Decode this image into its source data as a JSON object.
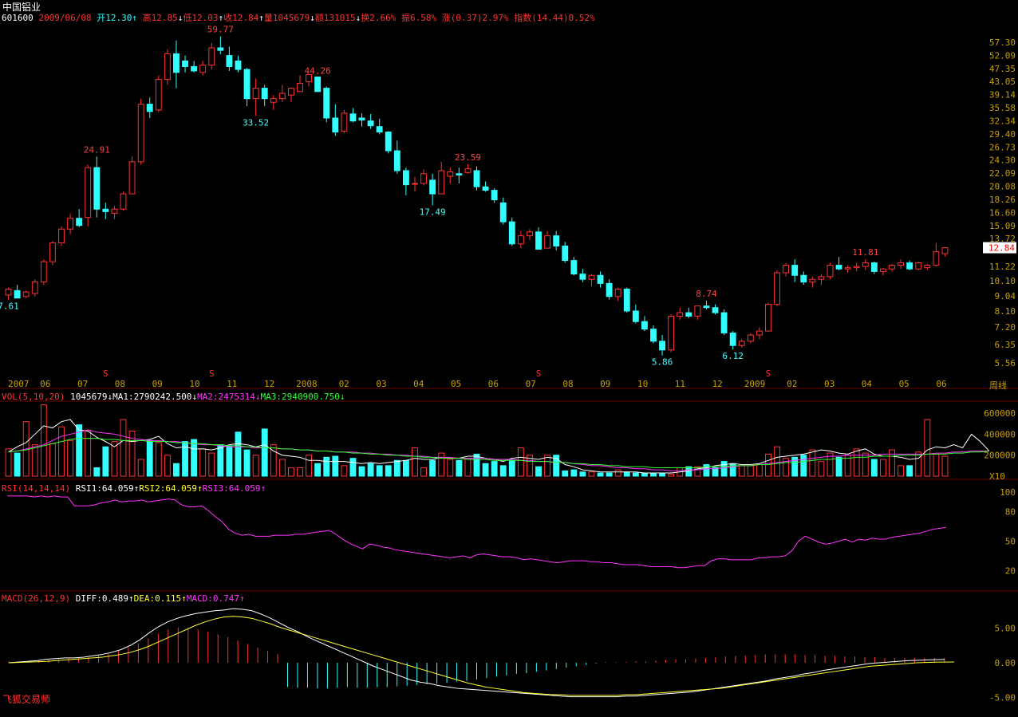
{
  "header": {
    "stock_name": "中国铝业",
    "stock_code": "601600",
    "date": "2009/06/08",
    "open_label": "开12.30",
    "high_label": "高12.85",
    "low_label": "低12.03",
    "close_label": "收12.84",
    "volume_label": "量1045679",
    "amount_label": "额131015",
    "turnover_label": "换2.66%",
    "amplitude_label": "振6.58%",
    "change_label": "涨(0.37)2.97%",
    "index_label": "指数(14.44)0.52%"
  },
  "period_label": "周线",
  "watermark": "飞狐交易师",
  "price_panel": {
    "y_ticks": [
      "57.30",
      "52.09",
      "47.35",
      "43.05",
      "39.14",
      "35.58",
      "32.34",
      "29.40",
      "26.73",
      "24.30",
      "22.09",
      "20.08",
      "18.26",
      "16.60",
      "15.09",
      "13.72",
      "11.22",
      "10.10",
      "9.04",
      "8.10",
      "7.20",
      "6.35",
      "5.56"
    ],
    "current_price": "12.84",
    "annotations": [
      {
        "text": "7.61",
        "color": "cyan"
      },
      {
        "text": "24.91",
        "color": "red"
      },
      {
        "text": "59.77",
        "color": "red"
      },
      {
        "text": "33.52",
        "color": "cyan"
      },
      {
        "text": "44.26",
        "color": "red"
      },
      {
        "text": "17.49",
        "color": "cyan"
      },
      {
        "text": "23.59",
        "color": "red"
      },
      {
        "text": "8.74",
        "color": "red"
      },
      {
        "text": "5.86",
        "color": "cyan"
      },
      {
        "text": "6.12",
        "color": "cyan"
      },
      {
        "text": "11.81",
        "color": "red"
      }
    ],
    "s_marker": "S",
    "x_labels": [
      "2007",
      "06",
      "07",
      "08",
      "09",
      "10",
      "11",
      "12",
      "2008",
      "02",
      "03",
      "04",
      "05",
      "06",
      "07",
      "08",
      "09",
      "10",
      "11",
      "12",
      "2009",
      "02",
      "03",
      "04",
      "05",
      "06"
    ]
  },
  "vol_panel": {
    "title": "VOL(5,10,20)",
    "value": "1045679",
    "ma1": "MA1:2790242.500",
    "ma2": "MA2:2475314",
    "ma3": "MA3:2940900.750",
    "y_ticks": [
      "600000",
      "400000",
      "200000"
    ],
    "unit": "X10"
  },
  "rsi_panel": {
    "title": "RSI(14,14,14)",
    "rsi1": "RSI1:64.059",
    "rsi2": "RSI2:64.059",
    "rsi3": "RSI3:64.059",
    "y_ticks": [
      "100",
      "80",
      "50",
      "20"
    ]
  },
  "macd_panel": {
    "title": "MACD(26,12,9)",
    "diff": "DIFF:0.489",
    "dea": "DEA:0.115",
    "macd": "MACD:0.747",
    "y_ticks": [
      "5.00",
      "0.00",
      "-5.00"
    ]
  },
  "colors": {
    "up": "#ff3232",
    "down": "#32ffff",
    "ma1": "#ffffff",
    "ma2": "#ff32ff",
    "ma3": "#32ff32",
    "rsi": "#ff32ff",
    "diff": "#ffffff",
    "dea": "#ffff32",
    "axis": "#c8a000"
  },
  "chart_data": {
    "type": "candlestick",
    "period": "weekly",
    "ohlc": [
      [
        9.1,
        9.6,
        8.8,
        9.5
      ],
      [
        9.4,
        9.8,
        9.0,
        8.9
      ],
      [
        9.0,
        9.4,
        8.9,
        9.3
      ],
      [
        9.2,
        10.2,
        9.0,
        10.0
      ],
      [
        10.0,
        11.8,
        9.8,
        11.6
      ],
      [
        11.6,
        13.5,
        11.3,
        13.3
      ],
      [
        13.3,
        15.0,
        13.0,
        14.7
      ],
      [
        14.7,
        16.5,
        14.2,
        15.9
      ],
      [
        15.9,
        17.0,
        14.9,
        15.1
      ],
      [
        16.0,
        23.5,
        15.0,
        23.0
      ],
      [
        23.0,
        24.91,
        16.0,
        17.0
      ],
      [
        17.0,
        17.8,
        15.8,
        16.7
      ],
      [
        16.5,
        17.4,
        15.8,
        17.0
      ],
      [
        17.0,
        19.3,
        16.8,
        19.0
      ],
      [
        19.0,
        25.0,
        19.0,
        24.0
      ],
      [
        24.0,
        38.0,
        23.5,
        36.5
      ],
      [
        36.5,
        38.3,
        33.0,
        34.6
      ],
      [
        35.0,
        45.0,
        34.5,
        43.7
      ],
      [
        43.7,
        54.5,
        42.0,
        52.7
      ],
      [
        52.7,
        58.0,
        41.0,
        46.0
      ],
      [
        50.0,
        52.0,
        46.0,
        48.0
      ],
      [
        48.0,
        50.0,
        46.0,
        46.5
      ],
      [
        46.0,
        50.0,
        45.0,
        48.5
      ],
      [
        48.5,
        57.0,
        47.0,
        55.0
      ],
      [
        55.0,
        59.77,
        52.5,
        54.0
      ],
      [
        52.0,
        55.5,
        46.5,
        48.0
      ],
      [
        50.0,
        52.0,
        46.0,
        47.0
      ],
      [
        47.0,
        47.5,
        36.0,
        38.0
      ],
      [
        38.0,
        44.0,
        33.52,
        41.0
      ],
      [
        41.0,
        42.0,
        36.0,
        38.0
      ],
      [
        37.0,
        39.0,
        35.0,
        38.0
      ],
      [
        38.0,
        42.0,
        37.0,
        39.5
      ],
      [
        39.0,
        41.0,
        37.0,
        41.0
      ],
      [
        40.0,
        45.0,
        40.0,
        42.5
      ],
      [
        43.0,
        45.5,
        41.5,
        45.3
      ],
      [
        44.5,
        44.26,
        41.0,
        40.0
      ],
      [
        41.0,
        41.5,
        32.0,
        33.0
      ],
      [
        33.0,
        36.5,
        29.0,
        29.8
      ],
      [
        30.0,
        35.0,
        29.6,
        34.2
      ],
      [
        34.0,
        35.5,
        32.0,
        32.3
      ],
      [
        33.0,
        34.2,
        31.0,
        32.5
      ],
      [
        32.3,
        34.0,
        30.5,
        31.2
      ],
      [
        31.0,
        32.8,
        29.3,
        29.8
      ],
      [
        29.8,
        30.0,
        25.5,
        26.0
      ],
      [
        26.0,
        28.0,
        22.0,
        22.5
      ],
      [
        22.5,
        23.0,
        18.8,
        20.3
      ],
      [
        20.5,
        21.5,
        19.3,
        20.5
      ],
      [
        20.5,
        22.7,
        20.2,
        22.0
      ],
      [
        21.0,
        22.0,
        17.49,
        19.0
      ],
      [
        19.0,
        24.0,
        19.0,
        22.5
      ],
      [
        21.6,
        23.0,
        20.5,
        22.3
      ],
      [
        22.0,
        23.0,
        20.5,
        21.8
      ],
      [
        22.2,
        23.59,
        22.0,
        22.8
      ],
      [
        22.5,
        23.2,
        19.5,
        20.0
      ],
      [
        20.0,
        20.8,
        19.3,
        19.5
      ],
      [
        19.5,
        19.8,
        17.8,
        18.2
      ],
      [
        17.8,
        18.5,
        15.2,
        15.5
      ],
      [
        15.5,
        16.0,
        13.0,
        13.2
      ],
      [
        13.2,
        14.5,
        12.8,
        14.0
      ],
      [
        14.0,
        14.7,
        13.6,
        14.4
      ],
      [
        14.4,
        14.9,
        12.7,
        12.7
      ],
      [
        12.8,
        14.5,
        12.8,
        14.0
      ],
      [
        14.0,
        14.5,
        12.6,
        13.0
      ],
      [
        13.0,
        13.4,
        11.5,
        11.7
      ],
      [
        11.7,
        12.0,
        10.5,
        10.6
      ],
      [
        10.6,
        11.0,
        10.0,
        10.2
      ],
      [
        10.2,
        10.6,
        9.7,
        10.5
      ],
      [
        10.5,
        10.8,
        9.6,
        9.9
      ],
      [
        9.9,
        10.2,
        8.8,
        9.0
      ],
      [
        9.0,
        9.6,
        8.7,
        9.5
      ],
      [
        9.5,
        9.6,
        8.0,
        8.1
      ],
      [
        8.1,
        8.5,
        7.4,
        7.5
      ],
      [
        7.5,
        7.8,
        7.0,
        7.1
      ],
      [
        7.1,
        7.3,
        6.4,
        6.5
      ],
      [
        6.5,
        6.8,
        5.86,
        6.1
      ],
      [
        6.1,
        7.9,
        6.0,
        7.8
      ],
      [
        7.8,
        8.3,
        7.6,
        8.0
      ],
      [
        8.0,
        8.3,
        7.7,
        7.8
      ],
      [
        7.8,
        8.4,
        7.6,
        8.4
      ],
      [
        8.4,
        8.74,
        8.2,
        8.3
      ],
      [
        8.3,
        8.5,
        7.9,
        8.0
      ],
      [
        8.0,
        8.2,
        6.8,
        6.9
      ],
      [
        6.9,
        7.0,
        6.12,
        6.3
      ],
      [
        6.3,
        6.6,
        6.2,
        6.5
      ],
      [
        6.5,
        6.9,
        6.4,
        6.8
      ],
      [
        6.8,
        7.2,
        6.6,
        7.0
      ],
      [
        7.0,
        8.6,
        7.0,
        8.5
      ],
      [
        8.5,
        10.9,
        8.4,
        10.7
      ],
      [
        10.7,
        11.5,
        10.4,
        11.3
      ],
      [
        11.3,
        11.8,
        10.0,
        10.5
      ],
      [
        10.5,
        10.8,
        9.8,
        10.0
      ],
      [
        10.0,
        10.4,
        9.6,
        10.2
      ],
      [
        10.2,
        10.6,
        9.8,
        10.4
      ],
      [
        10.4,
        11.5,
        10.2,
        11.3
      ],
      [
        11.3,
        12.0,
        10.9,
        11.0
      ],
      [
        11.0,
        11.3,
        10.7,
        11.1
      ],
      [
        11.1,
        11.5,
        10.8,
        11.2
      ],
      [
        11.2,
        11.81,
        10.9,
        11.5
      ],
      [
        11.5,
        11.6,
        10.6,
        10.8
      ],
      [
        10.8,
        11.1,
        10.5,
        11.0
      ],
      [
        11.0,
        11.4,
        10.8,
        11.3
      ],
      [
        11.3,
        11.8,
        11.0,
        11.5
      ],
      [
        11.5,
        11.7,
        10.9,
        11.0
      ],
      [
        11.0,
        11.6,
        10.9,
        11.5
      ],
      [
        11.1,
        11.4,
        10.9,
        11.3
      ],
      [
        11.3,
        13.3,
        11.2,
        12.47
      ],
      [
        12.3,
        12.85,
        12.03,
        12.84
      ]
    ],
    "volume": [
      26,
      22,
      52,
      30,
      68,
      31,
      47,
      34,
      49,
      44,
      8,
      28,
      33,
      54,
      43,
      16,
      34,
      32,
      20,
      12,
      33,
      35,
      26,
      22,
      30,
      29,
      42,
      25,
      20,
      45,
      30,
      16,
      8,
      8,
      20,
      12,
      18,
      19,
      10,
      17,
      9,
      12,
      10,
      10,
      15,
      15,
      27,
      8,
      15,
      22,
      16,
      15,
      17,
      21,
      12,
      14,
      10,
      15,
      27,
      20,
      9,
      20,
      20,
      5,
      6,
      4,
      4,
      3,
      3,
      6,
      4,
      3,
      3,
      3,
      3,
      2,
      8,
      9,
      9,
      11,
      8,
      14,
      12,
      10,
      10,
      11,
      21,
      28,
      17,
      18,
      20,
      25,
      14,
      22,
      18,
      20,
      26,
      22,
      16,
      16,
      25,
      10,
      10,
      23,
      54,
      21,
      19,
      34,
      10,
      70,
      15,
      20
    ],
    "ma1": [
      23,
      28,
      32,
      40,
      48,
      46,
      52,
      54,
      44,
      43,
      37,
      33,
      28,
      34,
      33,
      34,
      35,
      38,
      31,
      27,
      28,
      26,
      26,
      25,
      27,
      30,
      31,
      30,
      28,
      30,
      24,
      20,
      19,
      18,
      15,
      15,
      14,
      14,
      14,
      13,
      12,
      13,
      12,
      13,
      14,
      15,
      17,
      16,
      16,
      18,
      17,
      17,
      19,
      19,
      17,
      16,
      14,
      17,
      18,
      17,
      16,
      18,
      17,
      11,
      9,
      6,
      5,
      4,
      4,
      4,
      4,
      4,
      3,
      3,
      3,
      3,
      4,
      5,
      7,
      8,
      10,
      11,
      12,
      11,
      11,
      12,
      15,
      18,
      19,
      20,
      21,
      23,
      25,
      24,
      22,
      21,
      24,
      26,
      21,
      19,
      19,
      18,
      16,
      17,
      25,
      28,
      27,
      30,
      27,
      40,
      33,
      24
    ],
    "ma2": [
      23,
      24,
      26,
      28,
      30,
      34,
      38,
      40,
      42,
      44,
      42,
      41,
      40,
      38,
      36,
      35,
      34,
      34,
      33,
      33,
      32,
      31,
      30,
      30,
      29,
      28,
      28,
      28,
      27,
      27,
      27,
      26,
      26,
      25,
      25,
      24,
      24,
      23,
      23,
      23,
      22,
      22,
      21,
      21,
      20,
      20,
      19,
      19,
      18,
      18,
      18,
      17,
      17,
      17,
      17,
      16,
      16,
      16,
      15,
      15,
      14,
      14,
      13,
      13,
      12,
      11,
      10,
      10,
      9,
      8,
      8,
      7,
      7,
      6,
      6,
      5,
      5,
      6,
      6,
      7,
      7,
      8,
      9,
      10,
      10,
      11,
      12,
      13,
      14,
      15,
      16,
      17,
      18,
      19,
      19,
      20,
      20,
      20,
      20,
      21,
      21,
      21,
      21,
      21,
      21,
      22,
      22,
      23,
      23,
      24,
      24,
      24
    ],
    "ma3": [
      23,
      24,
      25,
      27,
      29,
      31,
      33,
      35,
      36,
      36,
      36,
      35,
      35,
      34,
      34,
      34,
      33,
      33,
      33,
      32,
      32,
      31,
      31,
      30,
      30,
      29,
      29,
      28,
      28,
      27,
      27,
      26,
      26,
      25,
      25,
      24,
      24,
      23,
      23,
      22,
      22,
      21,
      21,
      20,
      20,
      19,
      19,
      18,
      18,
      17,
      17,
      17,
      16,
      16,
      16,
      15,
      15,
      15,
      15,
      14,
      14,
      14,
      13,
      13,
      12,
      12,
      11,
      11,
      10,
      10,
      9,
      9,
      9,
      8,
      8,
      8,
      8,
      8,
      8,
      9,
      9,
      9,
      10,
      10,
      10,
      11,
      11,
      12,
      13,
      13,
      14,
      15,
      16,
      16,
      17,
      17,
      18,
      18,
      19,
      19,
      19,
      20,
      20,
      20,
      21,
      21,
      21,
      22,
      22,
      23,
      23,
      24
    ],
    "rsi": [
      96,
      96,
      96,
      96,
      95,
      96,
      95,
      96,
      95,
      95,
      86,
      86,
      86,
      87,
      89,
      90,
      92,
      90,
      91,
      91,
      92,
      90,
      91,
      92,
      93,
      92,
      87,
      85,
      85,
      86,
      81,
      75,
      70,
      62,
      58,
      56,
      57,
      55,
      55,
      55,
      56,
      56,
      56,
      57,
      57,
      58,
      59,
      60,
      61,
      57,
      52,
      48,
      45,
      42,
      47,
      46,
      44,
      43,
      41,
      40,
      39,
      38,
      37,
      36,
      35,
      34,
      33,
      34,
      35,
      33,
      36,
      37,
      36,
      35,
      34,
      34,
      33,
      31,
      32,
      31,
      30,
      29,
      28,
      29,
      30,
      30,
      30,
      29,
      29,
      28,
      28,
      27,
      26,
      26,
      26,
      25,
      24,
      24,
      24,
      24,
      23,
      23,
      24,
      25,
      25,
      30,
      32,
      32,
      31,
      31,
      31,
      31,
      33,
      33,
      34,
      34,
      35,
      40,
      50,
      55,
      52,
      49,
      47,
      48,
      50,
      52,
      49,
      52,
      51,
      53,
      52,
      52,
      54,
      55,
      56,
      57,
      58,
      60,
      62,
      63,
      64
    ],
    "macd_diff": [
      0.0,
      0.1,
      0.2,
      0.3,
      0.5,
      0.6,
      0.7,
      0.7,
      0.8,
      1.0,
      1.2,
      1.5,
      1.9,
      2.5,
      3.3,
      4.3,
      5.2,
      5.9,
      6.4,
      6.8,
      7.1,
      7.3,
      7.5,
      7.6,
      7.8,
      7.7,
      7.5,
      7.0,
      6.4,
      5.7,
      5.0,
      4.4,
      3.7,
      3.1,
      2.5,
      1.9,
      1.3,
      0.7,
      0.1,
      -0.5,
      -1.0,
      -1.5,
      -2.0,
      -2.5,
      -2.8,
      -3.0,
      -3.3,
      -3.5,
      -3.7,
      -3.8,
      -3.9,
      -4.0,
      -4.1,
      -4.2,
      -4.3,
      -4.4,
      -4.5,
      -4.6,
      -4.7,
      -4.8,
      -4.9,
      -4.9,
      -4.9,
      -4.9,
      -4.9,
      -4.9,
      -4.8,
      -4.8,
      -4.7,
      -4.6,
      -4.5,
      -4.4,
      -4.3,
      -4.2,
      -4.0,
      -3.8,
      -3.6,
      -3.4,
      -3.2,
      -3.0,
      -2.8,
      -2.6,
      -2.3,
      -2.1,
      -1.9,
      -1.6,
      -1.4,
      -1.1,
      -0.9,
      -0.7,
      -0.5,
      -0.3,
      -0.1,
      0.0,
      0.1,
      0.2,
      0.3,
      0.35,
      0.4,
      0.45,
      0.48
    ],
    "macd_dea": [
      0.0,
      0.05,
      0.1,
      0.15,
      0.2,
      0.3,
      0.4,
      0.5,
      0.6,
      0.7,
      0.8,
      1.0,
      1.2,
      1.5,
      1.9,
      2.4,
      3.0,
      3.6,
      4.2,
      4.8,
      5.4,
      5.9,
      6.3,
      6.6,
      6.7,
      6.6,
      6.4,
      6.0,
      5.6,
      5.1,
      4.7,
      4.3,
      3.9,
      3.5,
      3.1,
      2.7,
      2.3,
      1.9,
      1.5,
      1.1,
      0.7,
      0.3,
      -0.1,
      -0.5,
      -0.9,
      -1.3,
      -1.7,
      -2.1,
      -2.5,
      -2.9,
      -3.2,
      -3.5,
      -3.7,
      -3.9,
      -4.1,
      -4.3,
      -4.4,
      -4.5,
      -4.6,
      -4.6,
      -4.7,
      -4.7,
      -4.7,
      -4.7,
      -4.7,
      -4.7,
      -4.6,
      -4.6,
      -4.5,
      -4.4,
      -4.3,
      -4.2,
      -4.1,
      -4.0,
      -3.9,
      -3.8,
      -3.7,
      -3.5,
      -3.3,
      -3.1,
      -2.9,
      -2.7,
      -2.5,
      -2.3,
      -2.1,
      -1.9,
      -1.7,
      -1.5,
      -1.3,
      -1.1,
      -0.9,
      -0.7,
      -0.5,
      -0.4,
      -0.3,
      -0.2,
      -0.1,
      0.0,
      0.05,
      0.08,
      0.1,
      0.12
    ],
    "macd_bar": [
      0.2,
      0.2,
      0.3,
      0.3,
      0.4,
      0.5,
      0.6,
      0.7,
      0.8,
      1.0,
      1.3,
      1.7,
      2.2,
      2.8,
      3.5,
      4.2,
      4.8,
      5.1,
      5.0,
      4.8,
      4.5,
      4.1,
      3.7,
      3.2,
      2.7,
      2.2,
      1.7,
      1.3,
      -3.5,
      -3.6,
      -3.6,
      -3.7,
      -3.7,
      -3.6,
      -3.5,
      -3.6,
      -3.6,
      -3.5,
      -3.5,
      -3.4,
      -3.3,
      -3.2,
      -3.1,
      -3.0,
      -2.9,
      -2.7,
      -2.6,
      -2.4,
      -2.2,
      -2.0,
      -1.8,
      -1.6,
      -1.5,
      -1.3,
      -1.1,
      -0.9,
      -0.7,
      -0.5,
      -0.3,
      -0.1,
      0.1,
      0.1,
      0.1,
      0.2,
      0.2,
      0.3,
      0.4,
      0.5,
      0.5,
      0.6,
      0.7,
      0.8,
      0.9,
      1.0,
      1.0,
      1.1,
      1.2,
      1.2,
      1.2,
      1.2,
      1.1,
      1.1,
      1.0,
      1.0,
      0.9,
      0.9,
      0.8,
      0.8,
      0.7,
      0.7,
      0.7,
      0.7,
      0.7,
      0.7,
      0.7
    ]
  }
}
